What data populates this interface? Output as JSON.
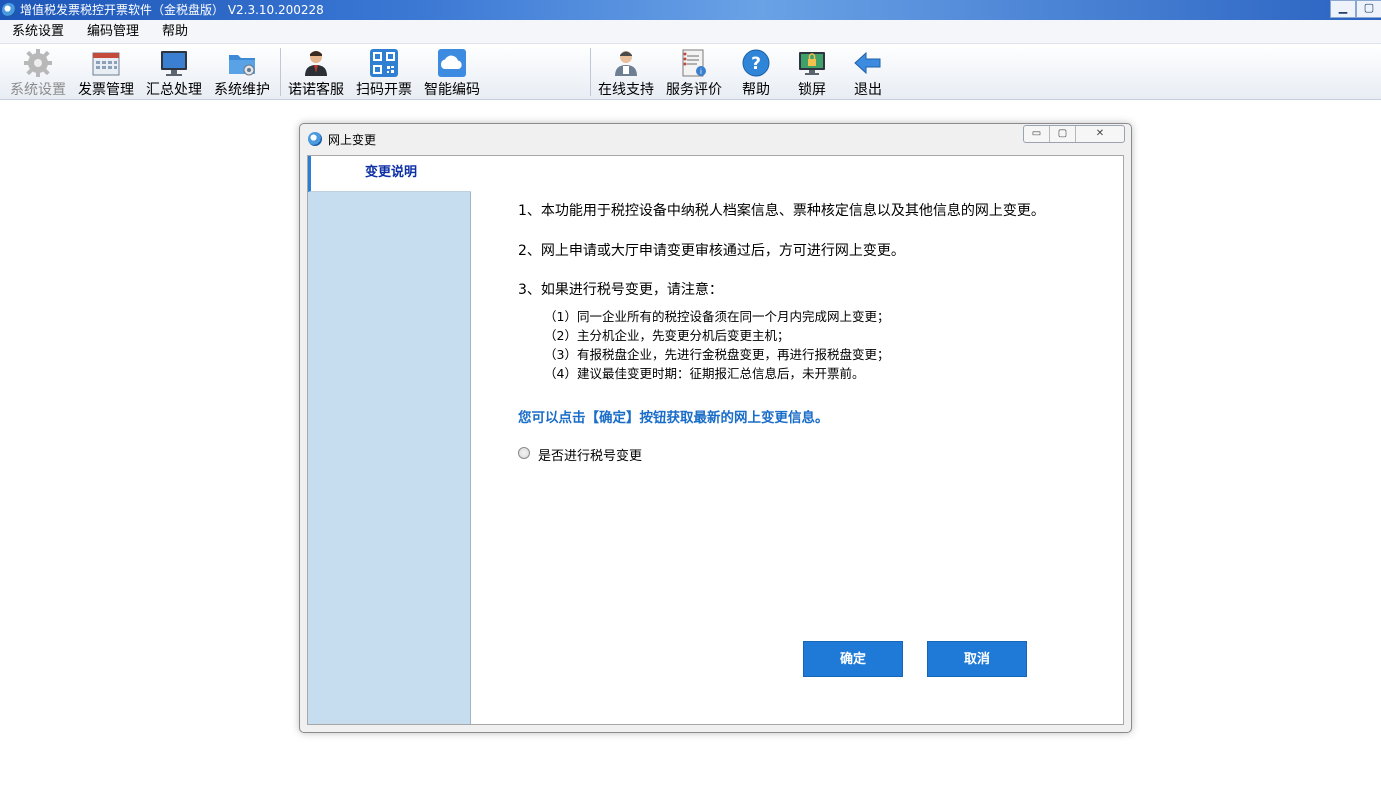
{
  "app": {
    "title": "增值税发票税控开票软件（金税盘版） V2.3.10.200228"
  },
  "window_controls": {
    "minimize": "▁",
    "maximize": "▢"
  },
  "menubar": {
    "items": [
      {
        "label": "系统设置"
      },
      {
        "label": "编码管理"
      },
      {
        "label": "帮助"
      }
    ]
  },
  "toolbar": {
    "items": [
      {
        "label": "系统设置",
        "icon": "gear-icon",
        "disabled": true
      },
      {
        "label": "发票管理",
        "icon": "invoice-icon"
      },
      {
        "label": "汇总处理",
        "icon": "monitor-icon"
      },
      {
        "label": "系统维护",
        "icon": "folder-settings-icon"
      },
      {
        "label": "诺诺客服",
        "icon": "customer-service-icon"
      },
      {
        "label": "扫码开票",
        "icon": "qr-code-icon"
      },
      {
        "label": "智能编码",
        "icon": "cloud-icon"
      },
      {
        "label": "在线支持",
        "icon": "user-support-icon"
      },
      {
        "label": "服务评价",
        "icon": "evaluation-icon"
      },
      {
        "label": "帮助",
        "icon": "help-icon"
      },
      {
        "label": "锁屏",
        "icon": "lock-screen-icon"
      },
      {
        "label": "退出",
        "icon": "exit-arrow-icon"
      }
    ]
  },
  "dialog": {
    "title": "网上变更",
    "controls": {
      "minimize": "▭",
      "restore": "▢",
      "close": "✕"
    },
    "sidebar_tab": "变更说明",
    "lines": [
      "1、本功能用于税控设备中纳税人档案信息、票种核定信息以及其他信息的网上变更。",
      "2、网上申请或大厅申请变更审核通过后，方可进行网上变更。",
      "3、如果进行税号变更，请注意："
    ],
    "sub_lines": [
      "（1）同一企业所有的税控设备须在同一个月内完成网上变更；",
      "（2）主分机企业，先变更分机后变更主机；",
      "（3）有报税盘企业，先进行金税盘变更，再进行报税盘变更；",
      "（4）建议最佳变更时期：征期报汇总信息后，未开票前。"
    ],
    "hint": "您可以点击【确定】按钮获取最新的网上变更信息。",
    "radio_label": "是否进行税号变更",
    "ok_label": "确定",
    "cancel_label": "取消"
  },
  "colors": {
    "accent_button": "#1f7ad7",
    "hint_text": "#1a6dc8",
    "sidebar_bg": "#c6ddf0",
    "sidebar_tab_text": "#0c2fa6"
  }
}
